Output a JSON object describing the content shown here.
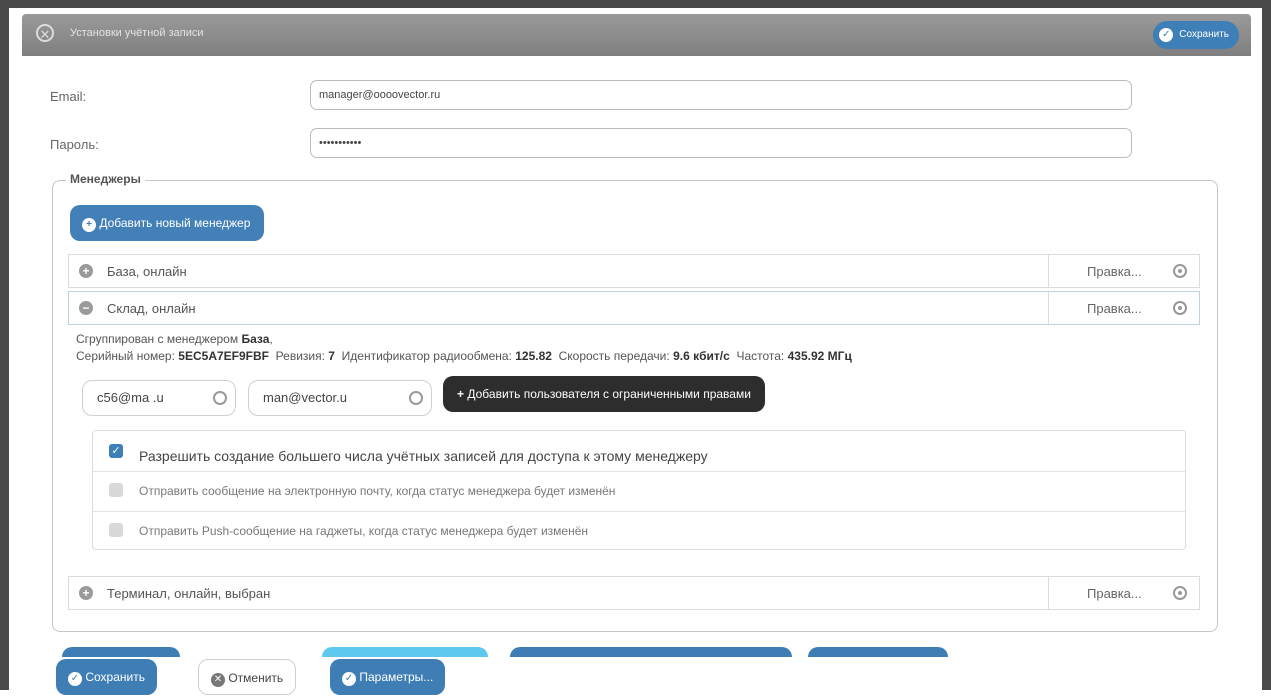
{
  "window": {
    "title": "Установки учётной записи",
    "save_label": "Сохранить"
  },
  "form": {
    "email_label": "Email:",
    "email_value": "manager@oooovector.ru",
    "password_label": "Пароль:",
    "password_value": "•••••••••••"
  },
  "managers": {
    "legend": "Менеджеры",
    "add_button": "Добавить новый менеджер",
    "edit_label": "Правка...",
    "items": [
      {
        "name": "База, онлайн",
        "expanded": false
      },
      {
        "name": "Склад, онлайн",
        "expanded": true
      },
      {
        "name": "Терминал, онлайн, выбран",
        "expanded": false
      }
    ],
    "details": {
      "grouped_prefix": "Сгруппирован с менеджером",
      "grouped_with": "База",
      "serial_label": "Серийный номер:",
      "serial": "5EC5A7EF9FBF",
      "revision_label": "Ревизия:",
      "revision": "7",
      "radio_id_label": "Идентификатор радиообмена:",
      "radio_id": "125.82",
      "speed_label": "Скорость передачи:",
      "speed": "9.6 кбит/с",
      "freq_label": "Частота:",
      "freq": "435.92 МГц",
      "users": [
        "c56@ma .u",
        "man@vector.u"
      ],
      "add_user_button": "Добавить пользователя с ограниченными правами",
      "options": [
        {
          "label": "Разрешить создание большего числа учётных записей для доступа к этому менеджеру",
          "checked": true
        },
        {
          "label": "Отправить сообщение на электронную почту, когда статус менеджера будет изменён",
          "checked": false
        },
        {
          "label": "Отправить Push-сообщение на гаджеты, когда статус менеджера будет изменён",
          "checked": false
        }
      ]
    }
  },
  "footer": {
    "save": "Сохранить",
    "cancel": "Отменить",
    "params": "Параметры..."
  },
  "colors": {
    "accent": "#3e7fb7",
    "titlebar": "#8c8c8c",
    "dark_button": "#2d2d2d"
  }
}
